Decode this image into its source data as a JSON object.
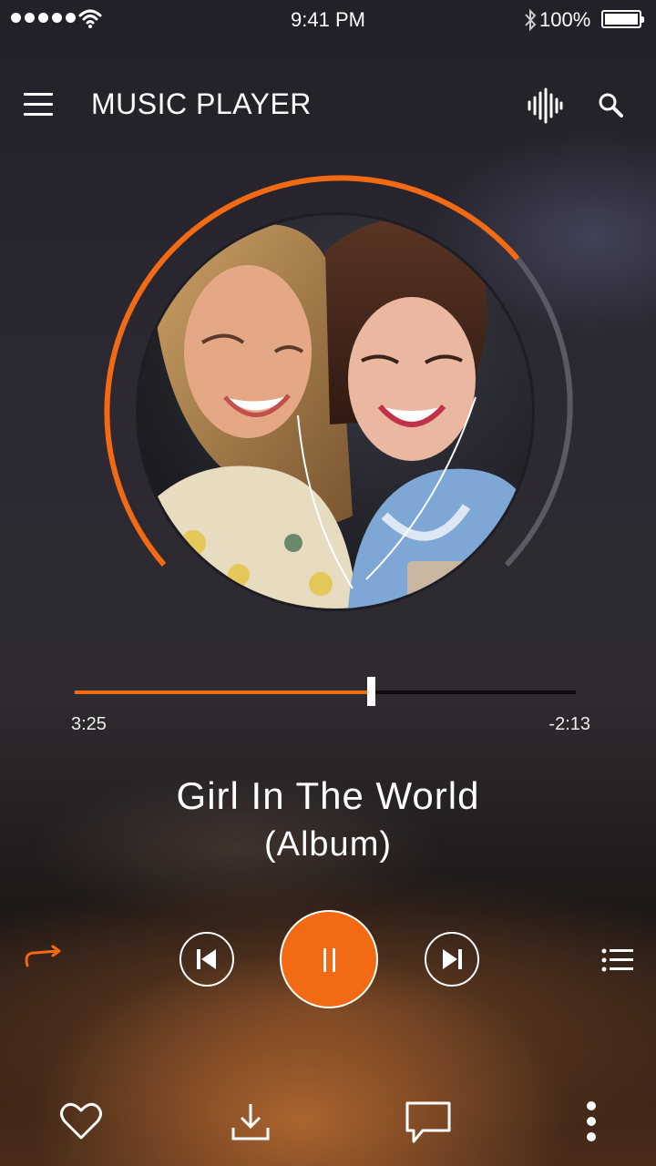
{
  "status_bar": {
    "time": "9:41 PM",
    "battery_percent": "100%",
    "icons": [
      "signal-icon",
      "wifi-icon",
      "bluetooth-icon",
      "battery-icon"
    ]
  },
  "header": {
    "title": "MUSIC PLAYER",
    "icons": [
      "menu-icon",
      "equalizer-icon",
      "search-icon"
    ]
  },
  "player": {
    "elapsed": "3:25",
    "remaining": "-2:13",
    "progress": 0.59,
    "song_title": "Girl In The World",
    "album": "(Album)",
    "state": "playing"
  },
  "controls": {
    "icons": [
      "repeat-icon",
      "previous-icon",
      "pause-icon",
      "next-icon",
      "playlist-icon"
    ]
  },
  "bottom_bar": {
    "icons": [
      "heart-icon",
      "download-icon",
      "comment-icon",
      "more-icon"
    ]
  },
  "colors": {
    "accent": "#f26a14",
    "ring_remaining": "#5a5a66"
  }
}
